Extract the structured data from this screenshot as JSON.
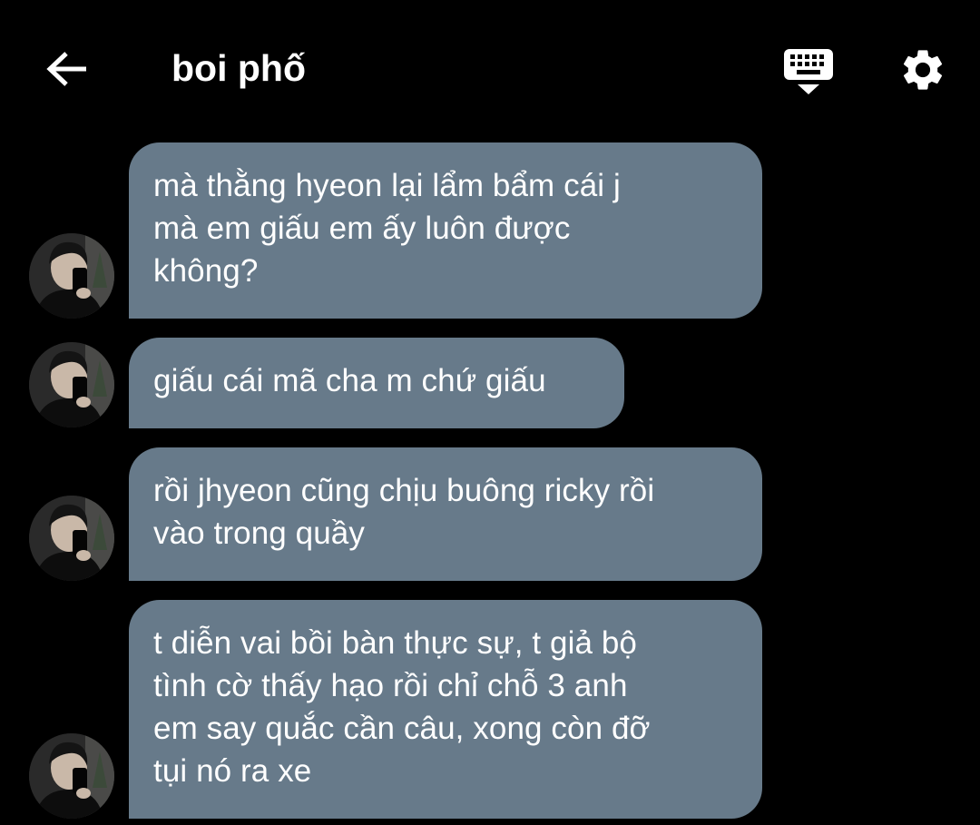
{
  "header": {
    "back_icon": "arrow-left-icon",
    "title": "boi phố",
    "keyboard_icon": "keyboard-hide-icon",
    "settings_icon": "gear-icon"
  },
  "theme": {
    "background": "#000000",
    "bubble_color": "#677a8a",
    "text_color": "#ffffff"
  },
  "messages": [
    {
      "sender": "incoming",
      "text": "mà thằng hyeon lại lẩm bẩm cái j\nmà em giấu em ấy luôn được\nkhông?"
    },
    {
      "sender": "incoming",
      "text": "giấu cái mã cha m chứ giấu"
    },
    {
      "sender": "incoming",
      "text": "rồi jhyeon cũng chịu buông ricky rồi\nvào trong quầy"
    },
    {
      "sender": "incoming",
      "text": "t diễn vai bồi bàn thực sự, t giả bộ\ntình cờ thấy hạo rồi chỉ chỗ 3 anh\nem say quắc cần câu, xong còn đỡ\ntụi nó ra xe"
    }
  ]
}
